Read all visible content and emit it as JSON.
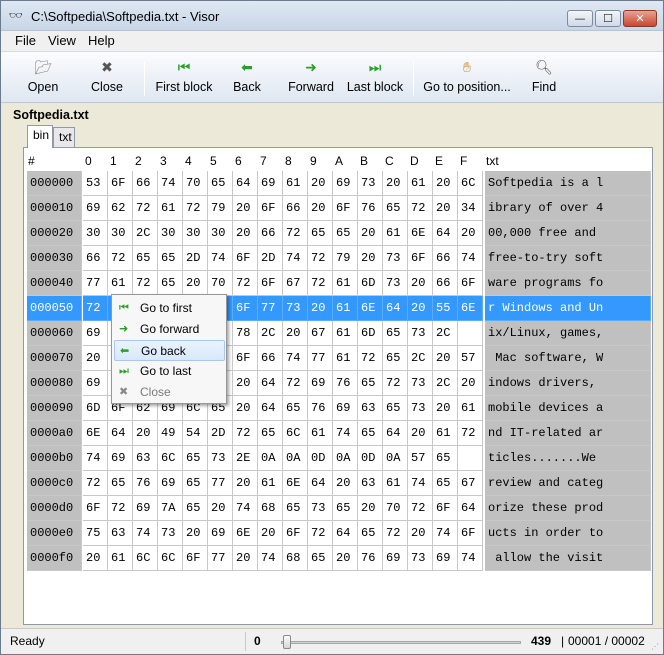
{
  "window": {
    "title": "C:\\Softpedia\\Softpedia.txt - Visor",
    "app_icon": "glasses-icon",
    "minimize_glyph": "—",
    "maximize_glyph": "☐",
    "close_glyph": "✕"
  },
  "menu": [
    "File",
    "View",
    "Help"
  ],
  "toolbar": {
    "open": "Open",
    "close": "Close",
    "first_block": "First block",
    "back": "Back",
    "forward": "Forward",
    "last_block": "Last block",
    "goto_position": "Go to position...",
    "find": "Find"
  },
  "document": {
    "name": "Softpedia.txt",
    "tabs": [
      "bin",
      "txt"
    ]
  },
  "grid": {
    "offset_header": "#",
    "hex_headers": [
      "0",
      "1",
      "2",
      "3",
      "4",
      "5",
      "6",
      "7",
      "8",
      "9",
      "A",
      "B",
      "C",
      "D",
      "E",
      "F"
    ],
    "text_header": "txt",
    "selected_row": 3,
    "rows": [
      {
        "offset": "000000",
        "hex": [
          "53",
          "6F",
          "66",
          "74",
          "70",
          "65",
          "64",
          "69",
          "61",
          "20",
          "69",
          "73",
          "20",
          "61",
          "20",
          "6C"
        ],
        "txt": "Softpedia is a l"
      },
      {
        "offset": "000010",
        "hex": [
          "69",
          "62",
          "72",
          "61",
          "72",
          "79",
          "20",
          "6F",
          "66",
          "20",
          "6F",
          "76",
          "65",
          "72",
          "20",
          "34"
        ],
        "txt": "ibrary of over 4"
      },
      {
        "offset": "000020",
        "hex": [
          "30",
          "30",
          "2C",
          "30",
          "30",
          "30",
          "20",
          "66",
          "72",
          "65",
          "65",
          "20",
          "61",
          "6E",
          "64",
          "20"
        ],
        "txt": "00,000 free and "
      },
      {
        "offset": "000030",
        "hex": [
          "66",
          "72",
          "65",
          "65",
          "2D",
          "74",
          "6F",
          "2D",
          "74",
          "72",
          "79",
          "20",
          "73",
          "6F",
          "66",
          "74"
        ],
        "txt": "free-to-try soft"
      },
      {
        "offset": "000040",
        "hex": [
          "77",
          "61",
          "72",
          "65",
          "20",
          "70",
          "72",
          "6F",
          "67",
          "72",
          "61",
          "6D",
          "73",
          "20",
          "66",
          "6F"
        ],
        "txt": "ware programs fo"
      },
      {
        "offset": "000050",
        "hex": [
          "72",
          "",
          "",
          "",
          "",
          "",
          "6F",
          "77",
          "73",
          "20",
          "61",
          "6E",
          "64",
          "20",
          "55",
          "6E"
        ],
        "txt": "r Windows and Un"
      },
      {
        "offset": "000060",
        "hex": [
          "69",
          "",
          "",
          "",
          "",
          "75",
          "78",
          "2C",
          "20",
          "67",
          "61",
          "6D",
          "65",
          "73",
          "2C",
          ""
        ],
        "txt": "ix/Linux, games,"
      },
      {
        "offset": "000070",
        "hex": [
          "20",
          "",
          "",
          "",
          "",
          "",
          "6F",
          "66",
          "74",
          "77",
          "61",
          "72",
          "65",
          "2C",
          "20",
          "57"
        ],
        "txt": " Mac software, W"
      },
      {
        "offset": "000080",
        "hex": [
          "69",
          "",
          "",
          "",
          "",
          "",
          "20",
          "64",
          "72",
          "69",
          "76",
          "65",
          "72",
          "73",
          "2C",
          "20"
        ],
        "txt": "indows drivers, "
      },
      {
        "offset": "000090",
        "hex": [
          "6D",
          "6F",
          "62",
          "69",
          "6C",
          "65",
          "20",
          "64",
          "65",
          "76",
          "69",
          "63",
          "65",
          "73",
          "20",
          "61"
        ],
        "txt": "mobile devices a"
      },
      {
        "offset": "0000a0",
        "hex": [
          "6E",
          "64",
          "20",
          "49",
          "54",
          "2D",
          "72",
          "65",
          "6C",
          "61",
          "74",
          "65",
          "64",
          "20",
          "61",
          "72"
        ],
        "txt": "nd IT-related ar"
      },
      {
        "offset": "0000b0",
        "hex": [
          "74",
          "69",
          "63",
          "6C",
          "65",
          "73",
          "2E",
          "0A",
          "0A",
          "0D",
          "0A",
          "0D",
          "0A",
          "57",
          "65",
          ""
        ],
        "txt": "ticles.......We "
      },
      {
        "offset": "0000c0",
        "hex": [
          "72",
          "65",
          "76",
          "69",
          "65",
          "77",
          "20",
          "61",
          "6E",
          "64",
          "20",
          "63",
          "61",
          "74",
          "65",
          "67"
        ],
        "txt": "review and categ"
      },
      {
        "offset": "0000d0",
        "hex": [
          "6F",
          "72",
          "69",
          "7A",
          "65",
          "20",
          "74",
          "68",
          "65",
          "73",
          "65",
          "20",
          "70",
          "72",
          "6F",
          "64"
        ],
        "txt": "orize these prod"
      },
      {
        "offset": "0000e0",
        "hex": [
          "75",
          "63",
          "74",
          "73",
          "20",
          "69",
          "6E",
          "20",
          "6F",
          "72",
          "64",
          "65",
          "72",
          "20",
          "74",
          "6F"
        ],
        "txt": "ucts in order to"
      },
      {
        "offset": "0000f0",
        "hex": [
          "20",
          "61",
          "6C",
          "6C",
          "6F",
          "77",
          "20",
          "74",
          "68",
          "65",
          "20",
          "76",
          "69",
          "73",
          "69",
          "74"
        ],
        "txt": " allow the visit"
      }
    ]
  },
  "context_menu": {
    "items": [
      {
        "label": "Go to first",
        "icon": "first-icon",
        "glyph": "⏮",
        "hover": false,
        "disabled": false
      },
      {
        "label": "Go forward",
        "icon": "forward-icon",
        "glyph": "➜",
        "hover": false,
        "disabled": false
      },
      {
        "label": "Go back",
        "icon": "back-icon",
        "glyph": "⬅",
        "hover": true,
        "disabled": false
      },
      {
        "label": "Go to last",
        "icon": "last-icon",
        "glyph": "⏭",
        "hover": false,
        "disabled": false
      },
      {
        "label": "Close",
        "icon": "close-icon",
        "glyph": "✖",
        "hover": false,
        "disabled": true
      }
    ]
  },
  "status": {
    "text": "Ready",
    "position": "0",
    "size": "439",
    "block": "00001 / 00002",
    "separator": "|"
  },
  "colors": {
    "selection": "#3399ff",
    "offset_column": "#c0c0c0",
    "toolbar_icon_green": "#28a028"
  }
}
